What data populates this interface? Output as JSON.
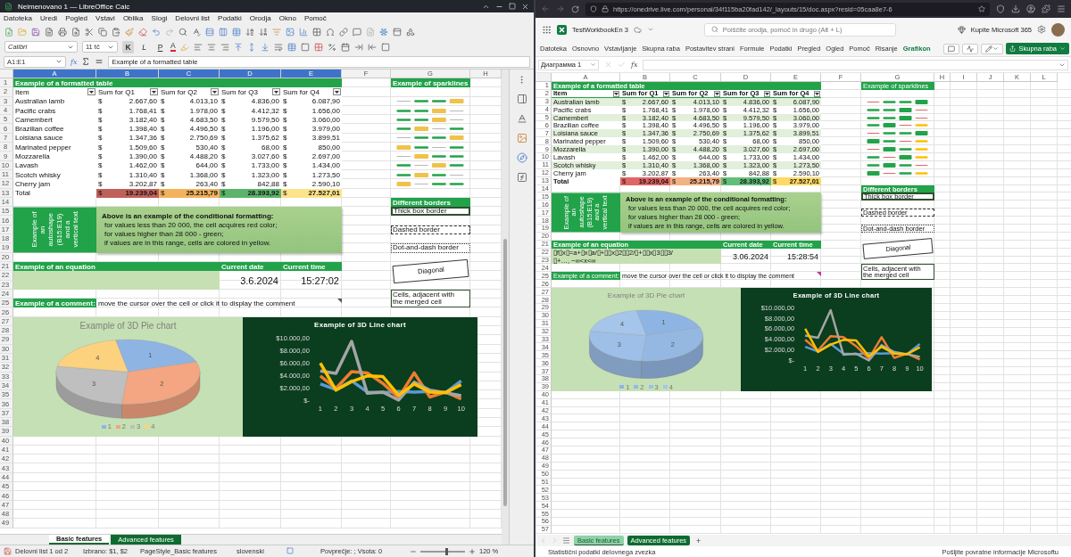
{
  "libreoffice": {
    "title": "Neimenovano 1 — LibreOffice Calc",
    "menu": [
      "Datoteka",
      "Uredi",
      "Pogled",
      "Vstavi",
      "Oblika",
      "Slogi",
      "Delovni list",
      "Podatki",
      "Orodja",
      "Okno",
      "Pomoč"
    ],
    "font_name": "Calibri",
    "font_size": "11 tč",
    "format_buttons": [
      {
        "label": "K",
        "selected": true
      },
      {
        "label": "L",
        "selected": false
      },
      {
        "label": "P",
        "selected": false
      }
    ],
    "font_color_label": "A",
    "name_box": "A1:E1",
    "function_label": "fx",
    "formula": "Example of a formatted table",
    "sheet": {
      "columns": [
        {
          "label": "A",
          "selected": true
        },
        {
          "label": "B",
          "selected": true
        },
        {
          "label": "C",
          "selected": true
        },
        {
          "label": "D",
          "selected": true
        },
        {
          "label": "E",
          "selected": true
        },
        {
          "label": "F",
          "selected": false
        },
        {
          "label": "G",
          "selected": false
        },
        {
          "label": "H",
          "selected": false
        }
      ],
      "rows": [
        "1",
        "2",
        "3",
        "4",
        "5",
        "6",
        "7",
        "8",
        "9",
        "10",
        "11",
        "12",
        "13",
        "14",
        "15",
        "16",
        "17",
        "18",
        "19",
        "20",
        "21",
        "22",
        "23",
        "24",
        "25",
        "26",
        "27",
        "28",
        "29",
        "30",
        "31",
        "32",
        "33",
        "34",
        "35",
        "36",
        "37",
        "38",
        "39",
        "40",
        "41",
        "42",
        "43",
        "44",
        "45",
        "46",
        "47",
        "48",
        "49"
      ],
      "table": {
        "title": "Example of a formatted table",
        "header": [
          "Item",
          "Sum for Q1",
          "Sum for Q2",
          "Sum for Q3",
          "Sum for Q4"
        ],
        "rows": [
          {
            "item": "Australian lamb",
            "cells": [
              [
                "$",
                "2.667,60"
              ],
              [
                "$",
                "4.013,10"
              ],
              [
                "$",
                "4.836,00"
              ],
              [
                "$",
                "6.087,90"
              ]
            ]
          },
          {
            "item": "Pacific crabs",
            "cells": [
              [
                "$",
                "1.768,41"
              ],
              [
                "$",
                "1.978,00"
              ],
              [
                "$",
                "4.412,32"
              ],
              [
                "$",
                "1.656,00"
              ]
            ]
          },
          {
            "item": "Camembert",
            "cells": [
              [
                "$",
                "3.182,40"
              ],
              [
                "$",
                "4.683,50"
              ],
              [
                "$",
                "9.579,50"
              ],
              [
                "$",
                "3.060,00"
              ]
            ]
          },
          {
            "item": "Brazilian coffee",
            "cells": [
              [
                "$",
                "1.398,40"
              ],
              [
                "$",
                "4.496,50"
              ],
              [
                "$",
                "1.196,00"
              ],
              [
                "$",
                "3.979,00"
              ]
            ]
          },
          {
            "item": "Loisiana sauce",
            "cells": [
              [
                "$",
                "1.347,36"
              ],
              [
                "$",
                "2.750,69"
              ],
              [
                "$",
                "1.375,62"
              ],
              [
                "$",
                "3.899,51"
              ]
            ]
          },
          {
            "item": "Marinated pepper",
            "cells": [
              [
                "$",
                "1.509,60"
              ],
              [
                "$",
                "530,40"
              ],
              [
                "$",
                "68,00"
              ],
              [
                "$",
                "850,00"
              ]
            ]
          },
          {
            "item": "Mozzarella",
            "cells": [
              [
                "$",
                "1.390,00"
              ],
              [
                "$",
                "4.488,20"
              ],
              [
                "$",
                "3.027,60"
              ],
              [
                "$",
                "2.697,00"
              ]
            ]
          },
          {
            "item": "Lavash",
            "cells": [
              [
                "$",
                "1.462,00"
              ],
              [
                "$",
                "644,00"
              ],
              [
                "$",
                "1.733,00"
              ],
              [
                "$",
                "1.434,00"
              ]
            ]
          },
          {
            "item": "Scotch whisky",
            "cells": [
              [
                "$",
                "1.310,40"
              ],
              [
                "$",
                "1.368,00"
              ],
              [
                "$",
                "1.323,00"
              ],
              [
                "$",
                "1.273,50"
              ]
            ]
          },
          {
            "item": "Cherry jam",
            "cells": [
              [
                "$",
                "3.202,87"
              ],
              [
                "$",
                "263,40"
              ],
              [
                "$",
                "842,88"
              ],
              [
                "$",
                "2.590,10"
              ]
            ]
          }
        ],
        "total": {
          "label": "Total",
          "cells": [
            {
              "currency": "$",
              "value": "19.239,04",
              "color": "#c0605a"
            },
            {
              "currency": "$",
              "value": "25.215,79",
              "color": "#f2b25e"
            },
            {
              "currency": "$",
              "value": "28.393,92",
              "color": "#5cb36b"
            },
            {
              "currency": "$",
              "value": "27.527,01",
              "color": "#fde38a"
            }
          ]
        }
      },
      "sparklines": {
        "title": "Example of sparklines"
      },
      "autoshape": {
        "text": "Example of an autoshape (B15:E19) and a vertical text"
      },
      "note": {
        "title": "Above is an example of the conditional formatting:",
        "lines": [
          "for values less than 20 000, the cell acquires red color;",
          "for values higher than 28 000 - green;",
          "if values are in this range, cells are colored in yellow."
        ]
      },
      "borders": {
        "title": "Different borders",
        "examples": [
          {
            "kind": "thick",
            "lines": [
              "Thick box border"
            ]
          },
          {
            "kind": "dashed",
            "lines": [
              "Dashed border"
            ]
          },
          {
            "kind": "dashdot",
            "lines": [
              "Dot-and-dash border"
            ]
          },
          {
            "kind": "diagonal",
            "lines": [
              "Diagonal"
            ]
          },
          {
            "kind": "merged",
            "lines": [
              "Cells, adjacent with",
              "the merged cell"
            ]
          }
        ]
      },
      "equation": {
        "title": "Example of an equation",
        "date_label": "Current date",
        "time_label": "Current time",
        "date": "3.6.2024",
        "time": "15:27:02"
      },
      "comment": {
        "label": "Example of a comment:",
        "text": "move the cursor over the cell or click it to display the comment"
      },
      "pie_chart": {
        "title": "Example of 3D Pie chart",
        "slice_labels": [
          "4",
          "1",
          "3",
          "2"
        ],
        "legend": [
          {
            "label": "1",
            "color": "#8eb4e3"
          },
          {
            "label": "2",
            "color": "#f4a582"
          },
          {
            "label": "3",
            "color": "#bfbfbf"
          },
          {
            "label": "4",
            "color": "#fcd27f"
          }
        ]
      },
      "line_chart": {
        "chart_data": {
          "type": "line",
          "title": "Example of 3D Line chart",
          "categories": [
            "1",
            "2",
            "3",
            "4",
            "5",
            "6",
            "7",
            "8",
            "9",
            "10"
          ],
          "ylim": [
            0,
            10000
          ],
          "yticks": [
            {
              "value": 0,
              "label": "$-"
            },
            {
              "value": 2000,
              "label": "$2.000,00"
            },
            {
              "value": 4000,
              "label": "$4.000,00"
            },
            {
              "value": 6000,
              "label": "$6.000,00"
            },
            {
              "value": 8000,
              "label": "$8.000,00"
            },
            {
              "value": 10000,
              "label": "$10.000,00"
            }
          ],
          "series": [
            {
              "color": "#5b9bd5",
              "values": [
                2700,
                1800,
                3200,
                1400,
                1300,
                1500,
                1400,
                1500,
                1300,
                3200
              ]
            },
            {
              "color": "#ed7d31",
              "values": [
                4000,
                2000,
                4700,
                4500,
                2800,
                500,
                4500,
                600,
                1400,
                300
              ]
            },
            {
              "color": "#a5a5a5",
              "values": [
                4800,
                4400,
                9600,
                1200,
                1400,
                100,
                3000,
                1700,
                1300,
                800
              ]
            },
            {
              "color": "#ffc000",
              "values": [
                6100,
                1700,
                3100,
                4000,
                3900,
                900,
                2700,
                1400,
                1300,
                2600
              ]
            }
          ]
        }
      }
    },
    "sheet_tabs": [
      {
        "label": "Basic features",
        "selected": true
      },
      {
        "label": "Advanced features",
        "selected": false
      }
    ],
    "status_bar": {
      "sheet": "Delovni list 1 od 2",
      "selection": "Izbrano: $1, $2",
      "page_style": "PageStyle_Basic features",
      "language": "slovenski",
      "summary": "Povprečje: ; Vsota: 0",
      "zoom": "120 %",
      "zoom_slider": {
        "level": 0.55
      }
    }
  },
  "excel": {
    "url": "https://onedrive.live.com/personal/34f115ba20fad142/_layouts/15/doc.aspx?resid=05caa8e7-6",
    "file_name": "TestWorkbookEn 3",
    "search_placeholder": "Poiščite orodja, pomoč in drugo (Alt + L)",
    "buy": "Kupite Microsoft 365",
    "ribbon_tabs": [
      {
        "label": "Datoteka",
        "selected": false
      },
      {
        "label": "Osnovno",
        "selected": false
      },
      {
        "label": "Vstavljanje",
        "selected": false
      },
      {
        "label": "Skupna raba",
        "selected": false
      },
      {
        "label": "Postavitev strani",
        "selected": false
      },
      {
        "label": "Formule",
        "selected": false
      },
      {
        "label": "Podatki",
        "selected": false
      },
      {
        "label": "Pregled",
        "selected": false
      },
      {
        "label": "Ogled",
        "selected": false
      },
      {
        "label": "Pomoč",
        "selected": false
      },
      {
        "label": "Risanje",
        "selected": false
      },
      {
        "label": "Grafikon",
        "selected": true
      }
    ],
    "share": "Skupna raba",
    "name_box": "Диаграмма 1",
    "function_label": "fx",
    "sheet": {
      "columns": [
        {
          "label": "A",
          "selected": false
        },
        {
          "label": "B",
          "selected": false
        },
        {
          "label": "C",
          "selected": false
        },
        {
          "label": "D",
          "selected": false
        },
        {
          "label": "E",
          "selected": false
        },
        {
          "label": "F",
          "selected": false
        },
        {
          "label": "G",
          "selected": false
        },
        {
          "label": "H",
          "selected": false
        },
        {
          "label": "I",
          "selected": false
        },
        {
          "label": "J",
          "selected": false
        },
        {
          "label": "K",
          "selected": false
        },
        {
          "label": "L",
          "selected": false
        }
      ],
      "rows": [
        "1",
        "2",
        "3",
        "4",
        "5",
        "6",
        "7",
        "8",
        "9",
        "10",
        "11",
        "12",
        "13",
        "14",
        "15",
        "16",
        "17",
        "18",
        "19",
        "20",
        "21",
        "22",
        "23",
        "24",
        "25",
        "26",
        "27",
        "28",
        "29",
        "30",
        "31",
        "32",
        "33",
        "34",
        "35",
        "36",
        "37",
        "38",
        "39",
        "40",
        "41",
        "42",
        "43",
        "44",
        "45",
        "46",
        "47",
        "48",
        "49",
        "50",
        "51",
        "52",
        "53",
        "54",
        "55",
        "56",
        "57"
      ],
      "table": {
        "title": "Example of a formatted table",
        "header": [
          "Item",
          "Sum for Q1",
          "Sum for Q2",
          "Sum for Q3",
          "Sum for Q4"
        ],
        "rows": [
          {
            "item": "Australian lamb",
            "cells": [
              [
                "$",
                "2.667,60"
              ],
              [
                "$",
                "4.013,10"
              ],
              [
                "$",
                "4.836,00"
              ],
              [
                "$",
                "6.087,90"
              ]
            ]
          },
          {
            "item": "Pacific crabs",
            "cells": [
              [
                "$",
                "1.768,41"
              ],
              [
                "$",
                "1.978,00"
              ],
              [
                "$",
                "4.412,32"
              ],
              [
                "$",
                "1.656,00"
              ]
            ]
          },
          {
            "item": "Camembert",
            "cells": [
              [
                "$",
                "3.182,40"
              ],
              [
                "$",
                "4.683,50"
              ],
              [
                "$",
                "9.579,50"
              ],
              [
                "$",
                "3.060,00"
              ]
            ]
          },
          {
            "item": "Brazilian coffee",
            "cells": [
              [
                "$",
                "1.398,40"
              ],
              [
                "$",
                "4.496,50"
              ],
              [
                "$",
                "1.196,00"
              ],
              [
                "$",
                "3.979,00"
              ]
            ]
          },
          {
            "item": "Loisiana sauce",
            "cells": [
              [
                "$",
                "1.347,36"
              ],
              [
                "$",
                "2.750,69"
              ],
              [
                "$",
                "1.375,62"
              ],
              [
                "$",
                "3.899,51"
              ]
            ]
          },
          {
            "item": "Marinated pepper",
            "cells": [
              [
                "$",
                "1.509,60"
              ],
              [
                "$",
                "530,40"
              ],
              [
                "$",
                "68,00"
              ],
              [
                "$",
                "850,00"
              ]
            ]
          },
          {
            "item": "Mozzarella",
            "cells": [
              [
                "$",
                "1.390,00"
              ],
              [
                "$",
                "4.488,20"
              ],
              [
                "$",
                "3.027,60"
              ],
              [
                "$",
                "2.697,00"
              ]
            ]
          },
          {
            "item": "Lavash",
            "cells": [
              [
                "$",
                "1.462,00"
              ],
              [
                "$",
                "644,00"
              ],
              [
                "$",
                "1.733,00"
              ],
              [
                "$",
                "1.434,00"
              ]
            ]
          },
          {
            "item": "Scotch whisky",
            "cells": [
              [
                "$",
                "1.310,40"
              ],
              [
                "$",
                "1.368,00"
              ],
              [
                "$",
                "1.323,00"
              ],
              [
                "$",
                "1.273,50"
              ]
            ]
          },
          {
            "item": "Cherry jam",
            "cells": [
              [
                "$",
                "3.202,87"
              ],
              [
                "$",
                "263,40"
              ],
              [
                "$",
                "842,88"
              ],
              [
                "$",
                "2.590,10"
              ]
            ]
          }
        ],
        "total": {
          "label": "Total",
          "cells": [
            {
              "currency": "$",
              "value": "19.239,04",
              "color": "#e06666"
            },
            {
              "currency": "$",
              "value": "25.215,79",
              "color": "#f4b183"
            },
            {
              "currency": "$",
              "value": "28.393,92",
              "color": "#63be7b"
            },
            {
              "currency": "$",
              "value": "27.527,01",
              "color": "#ffd966"
            }
          ]
        }
      },
      "sparklines": {
        "title": "Example of sparklines"
      },
      "autoshape": {
        "text": "Example of an autoshape (B15:E19) and a vertical text"
      },
      "note": {
        "title": "Above is an example of the conditional formatting:",
        "lines": [
          "for values less than 20 000, the cell acquires red color;",
          "for values higher than 28 000 - green;",
          "if values are in this range, cells are colored in yellow."
        ]
      },
      "borders": {
        "title": "Different borders",
        "examples": [
          {
            "kind": "thick",
            "lines": [
              "Thick box border"
            ]
          },
          {
            "kind": "dashed",
            "lines": [
              "Dashed border"
            ]
          },
          {
            "kind": "dashdot",
            "lines": [
              "Dot-and-dash border"
            ]
          },
          {
            "kind": "diagonal",
            "lines": [
              "Diagonal"
            ]
          },
          {
            "kind": "merged",
            "lines": [
              "Cells, adjacent with",
              "the merged cell"
            ]
          }
        ]
      },
      "equation": {
        "title": "Example of an equation",
        "formula_lines": [
          "▯f▯x▯=a+▯x▯a/▯+▯▯x▯2▯▯2/▯+▯▯x▯3▯▯3/",
          "▯+…, −∞<x<∞"
        ],
        "date_label": "Current date",
        "time_label": "Current time",
        "date": "3.06.2024",
        "time": "15:28:54"
      },
      "comment": {
        "label": "Example of a comment:",
        "text": "move the cursor over the cell or click it to display the comment"
      },
      "pie_chart": {
        "title": "Example of 3D Pie chart",
        "slice_labels": [
          "4",
          "1",
          "3",
          "2"
        ],
        "legend": [
          {
            "label": "1"
          },
          {
            "label": "2"
          },
          {
            "label": "3"
          },
          {
            "label": "4"
          }
        ]
      },
      "line_chart": {
        "chart_data": {
          "type": "line",
          "title": "Example of 3D Line chart",
          "categories": [
            "1",
            "2",
            "3",
            "4",
            "5",
            "6",
            "7",
            "8",
            "9",
            "10"
          ],
          "ylim": [
            0,
            10000
          ],
          "yticks": [
            {
              "value": 0,
              "label": "$-"
            },
            {
              "value": 2000,
              "label": "$2.000,00"
            },
            {
              "value": 4000,
              "label": "$4.000,00"
            },
            {
              "value": 6000,
              "label": "$6.000,00"
            },
            {
              "value": 8000,
              "label": "$8.000,00"
            },
            {
              "value": 10000,
              "label": "$10.000,00"
            }
          ],
          "series": [
            {
              "color": "#5b9bd5",
              "values": [
                2700,
                1800,
                3200,
                1400,
                1300,
                1500,
                1400,
                1500,
                1300,
                3200
              ]
            },
            {
              "color": "#ed7d31",
              "values": [
                4000,
                2000,
                4700,
                4500,
                2800,
                500,
                4500,
                600,
                1400,
                300
              ]
            },
            {
              "color": "#a5a5a5",
              "values": [
                4800,
                4400,
                9600,
                1200,
                1400,
                100,
                3000,
                1700,
                1300,
                800
              ]
            },
            {
              "color": "#ffc000",
              "values": [
                6100,
                1700,
                3100,
                4000,
                3900,
                900,
                2700,
                1400,
                1300,
                2600
              ]
            }
          ]
        }
      }
    },
    "sheet_tabs": [
      {
        "label": "Basic features",
        "selected": true
      },
      {
        "label": "Advanced features",
        "selected": false
      }
    ],
    "add_sheet": "+",
    "status_bar": {
      "left": "Statistični podatki delovnega zvezka",
      "right": "Pošljite povratne informacije Microsoftu"
    }
  }
}
